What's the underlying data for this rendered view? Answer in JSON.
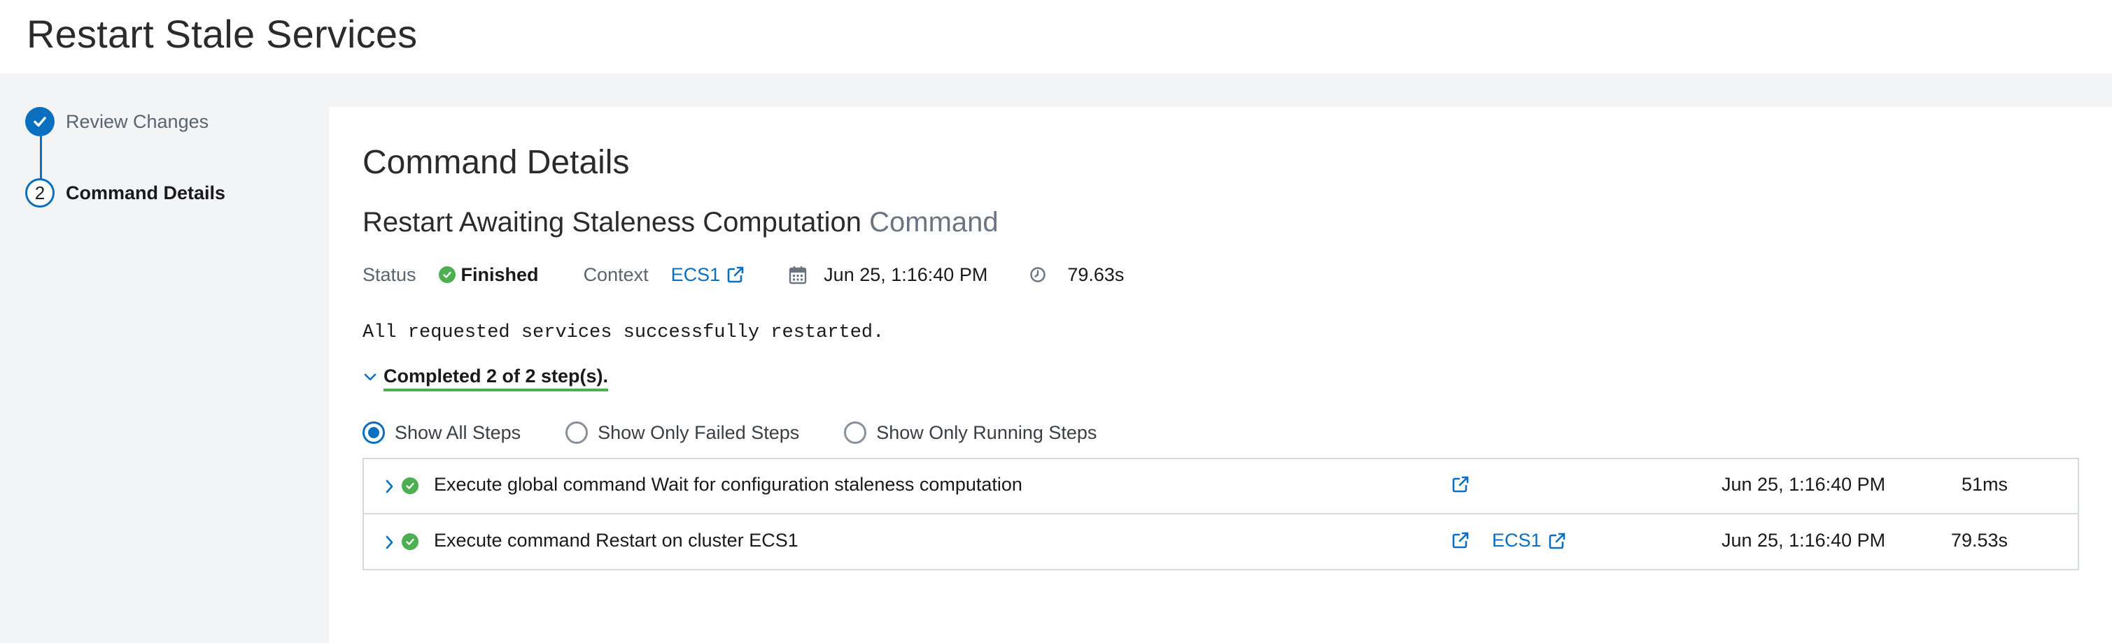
{
  "header": {
    "title": "Restart Stale Services"
  },
  "wizard": {
    "steps": [
      {
        "number": "",
        "label": "Review Changes",
        "state": "done"
      },
      {
        "number": "2",
        "label": "Command Details",
        "state": "active"
      }
    ]
  },
  "main": {
    "section_title": "Command Details",
    "command_name": "Restart Awaiting Staleness Computation",
    "command_suffix": "Command",
    "status_label": "Status",
    "status_value": "Finished",
    "context_label": "Context",
    "context_value": "ECS1",
    "date_value": "Jun 25, 1:16:40 PM",
    "duration_value": "79.63s",
    "result_message": "All requested services successfully restarted.",
    "steps_summary": "Completed 2 of 2 step(s).",
    "filters": [
      {
        "label": "Show All Steps",
        "selected": true
      },
      {
        "label": "Show Only Failed Steps",
        "selected": false
      },
      {
        "label": "Show Only Running Steps",
        "selected": false
      }
    ],
    "steps": [
      {
        "description": "Execute global command Wait for configuration staleness computation",
        "context": "",
        "date": "Jun 25, 1:16:40 PM",
        "duration": "51ms",
        "status_icon": "check-circle-icon"
      },
      {
        "description": "Execute command Restart on cluster ECS1",
        "context": "ECS1",
        "date": "Jun 25, 1:16:40 PM",
        "duration": "79.53s",
        "status_icon": "check-circle-icon"
      }
    ]
  },
  "colors": {
    "accent": "#0b6fbf",
    "success": "#4caf50",
    "background": "#f3f4f6"
  }
}
